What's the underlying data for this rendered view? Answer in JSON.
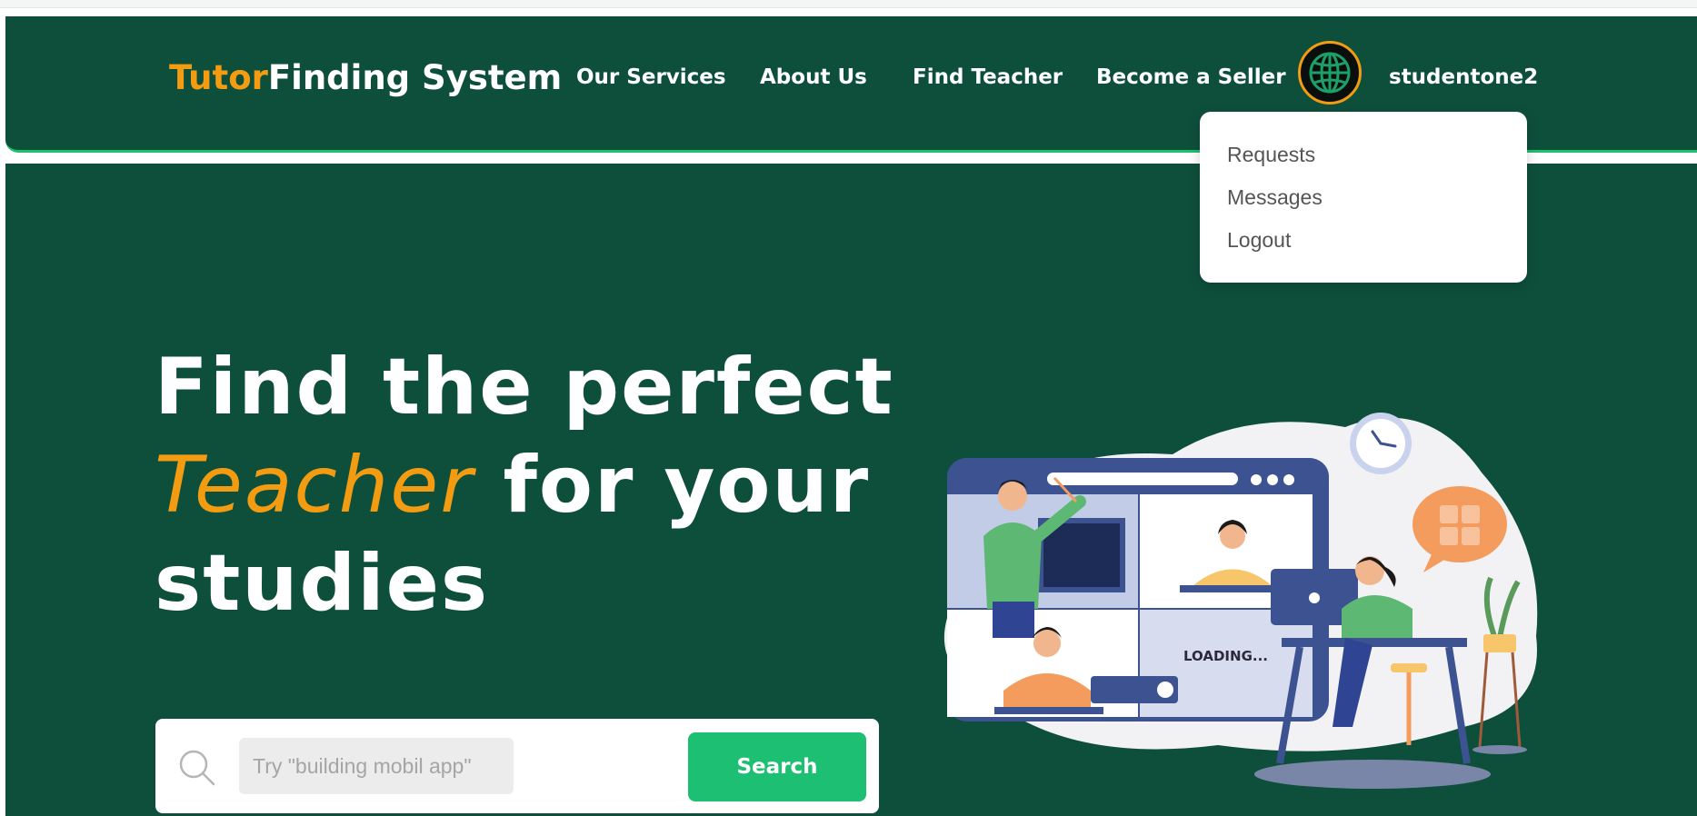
{
  "header": {
    "logo_accent": "Tutor",
    "logo_rest": "Finding System",
    "nav": {
      "services": "Our Services",
      "about": "About Us",
      "find_teacher": "Find Teacher",
      "become_seller": "Become a Seller"
    },
    "username": "studentone2"
  },
  "dropdown": {
    "requests": "Requests",
    "messages": "Messages",
    "logout": "Logout"
  },
  "hero": {
    "line1": "Find the perfect",
    "line2_accent": "Teacher",
    "line2_rest": " for your",
    "line3": "studies"
  },
  "search": {
    "placeholder": "Try \"building mobil app\"",
    "button_label": "Search"
  },
  "illustration": {
    "loading_text": "LOADING..."
  },
  "colors": {
    "brand_green": "#0e4f3c",
    "accent_orange": "#f39c12",
    "button_green": "#1dbf72"
  }
}
